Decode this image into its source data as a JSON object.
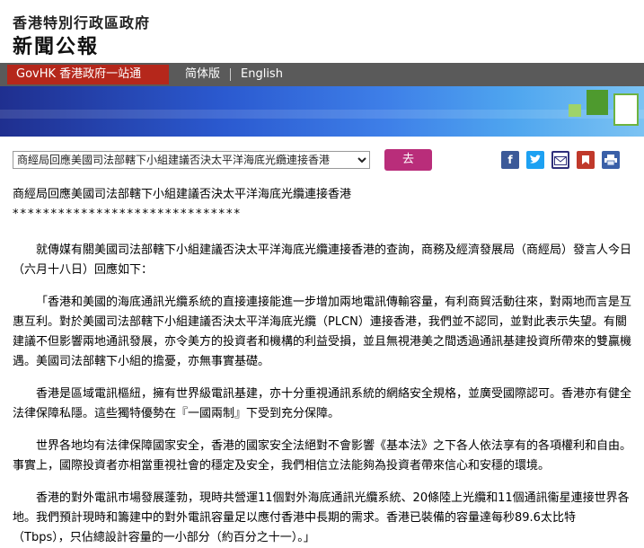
{
  "header": {
    "government": "香港特別行政區政府",
    "press_releases": "新聞公報"
  },
  "navbar": {
    "govhk": "GovHK 香港政府一站通",
    "simplified": "简体版",
    "english": "English"
  },
  "toolbar": {
    "selected_release": "商經局回應美國司法部轄下小組建議否決太平洋海底光纜連接香港",
    "go_label": "去",
    "share_icons": [
      "facebook-icon",
      "twitter-icon",
      "email-icon",
      "bookmark-icon",
      "print-icon"
    ]
  },
  "article": {
    "title": "商經局回應美國司法部轄下小組建議否決太平洋海底光纜連接香港",
    "stars": "******************************",
    "paragraphs": [
      "就傳媒有關美國司法部轄下小組建議否決太平洋海底光纜連接香港的查詢，商務及經濟發展局（商經局）發言人今日（六月十八日）回應如下：",
      "「香港和美國的海底通訊光纜系統的直接連接能進一步增加兩地電訊傳輸容量，有利商貿活動往來，對兩地而言是互惠互利。對於美國司法部轄下小組建議否決太平洋海底光纜（PLCN）連接香港，我們並不認同，並對此表示失望。有關建議不但影響兩地通訊發展，亦令美方的投資者和機構的利益受損，並且無視港美之間透過通訊基建投資所帶來的雙贏機遇。美國司法部轄下小組的擔憂，亦無事實基礎。",
      "香港是區域電訊樞紐，擁有世界級電訊基建，亦十分重視通訊系統的網絡安全規格，並廣受國際認可。香港亦有健全法律保障私隱。這些獨特優勢在『一國兩制』下受到充分保障。",
      "世界各地均有法律保障國家安全，香港的國家安全法絕對不會影響《基本法》之下各人依法享有的各項權利和自由。事實上，國際投資者亦相當重視社會的穩定及安全，我們相信立法能夠為投資者帶來信心和安穩的環境。",
      "香港的對外電訊市場發展蓬勃，現時共營運11個對外海底通訊光纜系統、20條陸上光纜和11個通訊衞星連接世界各地。我們預計現時和籌建中的對外電訊容量足以應付香港中長期的需求。香港已裝備的容量達每秒89.6太比特（Tbps），只佔總設計容量的一小部分（約百分之十一）。」"
    ]
  },
  "colors": {
    "govhk_red": "#b5271b",
    "go_button": "#b92d7a",
    "navbar_grey": "#5a5a5a",
    "banner_blue": "#2b5ad0",
    "facebook": "#3b5998",
    "twitter": "#1da1f2",
    "email": "#2f2f7a",
    "bookmark": "#c0392b",
    "print": "#3a60a8"
  }
}
